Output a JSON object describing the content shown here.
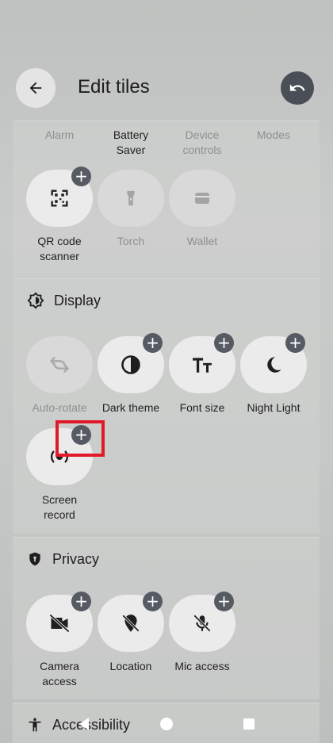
{
  "header": {
    "title": "Edit tiles"
  },
  "top_section": {
    "labels": [
      {
        "text": "Alarm",
        "dim": true
      },
      {
        "text": "Battery Saver",
        "dim": false
      },
      {
        "text": "Device controls",
        "dim": true
      },
      {
        "text": "Modes",
        "dim": true
      }
    ],
    "tiles": [
      {
        "label": "QR code scanner",
        "icon": "qr-code-icon",
        "addable": true
      },
      {
        "label": "Torch",
        "icon": "torch-icon",
        "addable": false
      },
      {
        "label": "Wallet",
        "icon": "wallet-icon",
        "addable": false
      }
    ]
  },
  "display_section": {
    "title": "Display",
    "tiles": [
      {
        "label": "Auto-rotate",
        "icon": "auto-rotate-icon",
        "addable": false
      },
      {
        "label": "Dark theme",
        "icon": "dark-theme-icon",
        "addable": true
      },
      {
        "label": "Font size",
        "icon": "font-size-icon",
        "addable": true
      },
      {
        "label": "Night Light",
        "icon": "night-light-icon",
        "addable": true
      },
      {
        "label": "Screen record",
        "icon": "screen-record-icon",
        "addable": true
      }
    ]
  },
  "privacy_section": {
    "title": "Privacy",
    "tiles": [
      {
        "label": "Camera access",
        "icon": "camera-off-icon",
        "addable": true
      },
      {
        "label": "Location",
        "icon": "location-off-icon",
        "addable": true
      },
      {
        "label": "Mic access",
        "icon": "mic-off-icon",
        "addable": true
      }
    ]
  },
  "accessibility_section": {
    "title": "Accessibility"
  },
  "colors": {
    "accent_plus": "#565a62",
    "highlight": "#e11a28"
  }
}
